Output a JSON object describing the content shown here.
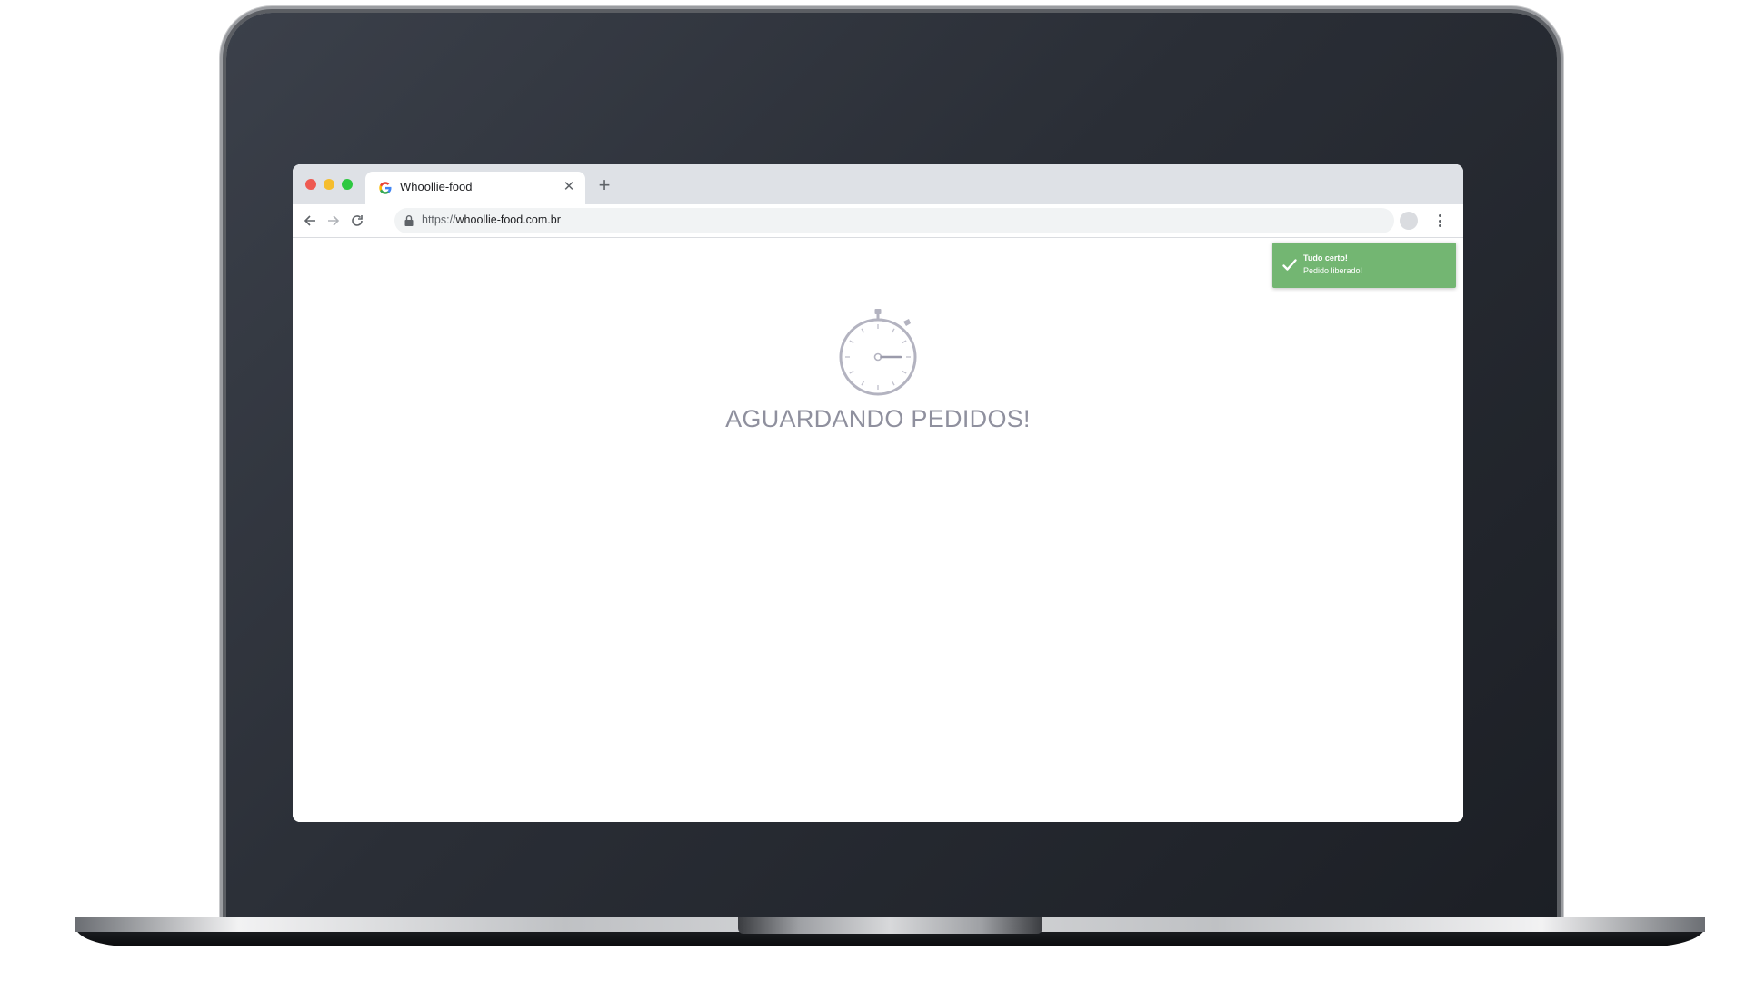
{
  "browser": {
    "tab": {
      "title": "Whoollie-food",
      "close_icon": "close-icon",
      "favicon": "google-favicon-icon"
    },
    "new_tab_icon": "plus-icon",
    "address_bar": {
      "scheme": "https://",
      "host": "whoollie-food.com.br"
    },
    "icons": {
      "back": "arrow-left-icon",
      "forward": "arrow-right-icon",
      "reload": "reload-icon",
      "lock": "lock-icon",
      "bookmark": "star-icon",
      "profile": "avatar",
      "menu": "kebab-menu-icon"
    }
  },
  "toast": {
    "title": "Tudo certo!",
    "message": "Pedido liberado!",
    "color": "#73b672",
    "icon": "check-icon"
  },
  "main": {
    "status_icon": "stopwatch-icon",
    "status_text": "AGUARDANDO PEDIDOS!"
  },
  "colors": {
    "window_close": "#ee5a52",
    "window_minimize": "#f5bd2e",
    "window_maximize": "#2dc840",
    "status_text": "#8f909e"
  }
}
